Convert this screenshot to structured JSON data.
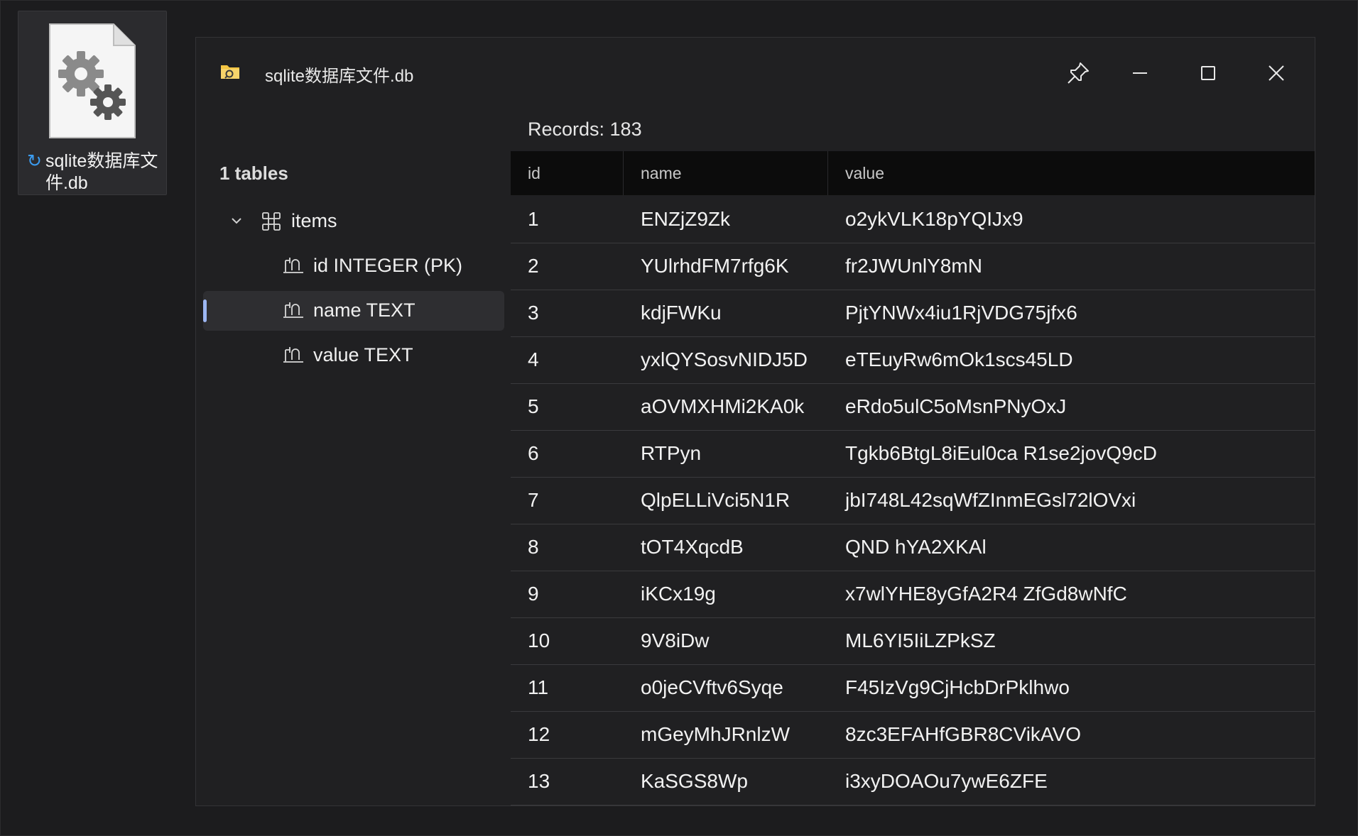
{
  "desktop": {
    "file_icon": "config-file-icon",
    "file_name": "sqlite数据库文件.db",
    "sync_icon": "sync-icon"
  },
  "window": {
    "title": "sqlite数据库文件.db",
    "title_icon": "folder-icon",
    "buttons": [
      "pin-icon",
      "minimize-icon",
      "maximize-icon",
      "close-icon"
    ]
  },
  "sidebar": {
    "tables_count": "1 tables",
    "table": {
      "label": "items",
      "icon": "table-icon",
      "expanded_icon": "chevron-down-icon"
    },
    "columns": [
      {
        "label": "id INTEGER (PK)",
        "icon": "column-icon"
      },
      {
        "label": "name TEXT",
        "icon": "column-icon",
        "selected": true
      },
      {
        "label": "value TEXT",
        "icon": "column-icon"
      }
    ]
  },
  "records_label": "Records: 183",
  "grid": {
    "headers": [
      "id",
      "name",
      "value"
    ],
    "rows": [
      [
        "1",
        "ENZjZ9Zk",
        "o2ykVLK18pYQIJx9"
      ],
      [
        "2",
        "YUlrhdFM7rfg6K",
        "fr2JWUnlY8mN"
      ],
      [
        "3",
        "kdjFWKu",
        "PjtYNWx4iu1RjVDG75jfx6"
      ],
      [
        "4",
        "yxlQYSosvNIDJ5D",
        "eTEuyRw6mOk1scs45LD"
      ],
      [
        "5",
        "aOVMXHMi2KA0k",
        "eRdo5ulC5oMsnPNyOxJ"
      ],
      [
        "6",
        "RTPyn",
        "Tgkb6BtgL8iEul0ca R1se2jovQ9cD"
      ],
      [
        "7",
        "QlpELLiVci5N1R",
        "jbI748L42sqWfZInmEGsl72lOVxi"
      ],
      [
        "8",
        "tOT4XqcdB",
        "QND hYA2XKAl"
      ],
      [
        "9",
        "iKCx19g",
        "x7wlYHE8yGfA2R4 ZfGd8wNfC"
      ],
      [
        "10",
        "9V8iDw",
        "ML6YI5IiLZPkSZ"
      ],
      [
        "11",
        "o0jeCVftv6Syqe",
        "F45IzVg9CjHcbDrPklhwo"
      ],
      [
        "12",
        "mGeyMhJRnlzW",
        "8zc3EFAHfGBR8CVikAVO"
      ],
      [
        "13",
        "KaSGS8Wp",
        "i3xyDOAOu7ywE6ZFE"
      ]
    ]
  },
  "colors": {
    "background": "#1c1c1e",
    "window": "#202022",
    "header_bg": "#0c0c0c",
    "row_divider": "#3a3a3d",
    "selection_accent": "#9cb6f2",
    "sync_blue": "#3b9cf0",
    "folder_yellow": "#f4c542"
  }
}
